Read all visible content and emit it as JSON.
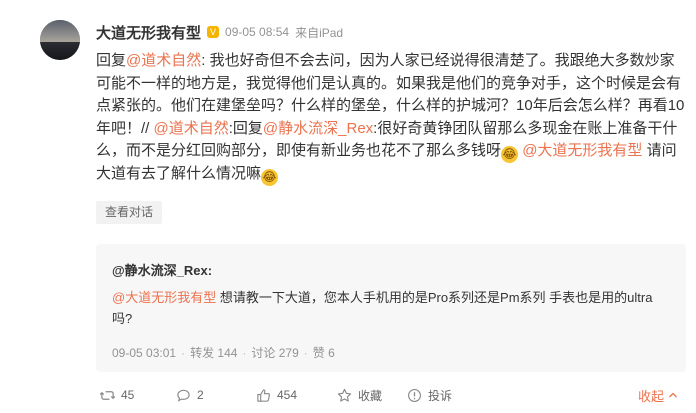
{
  "post": {
    "username": "大道无形我有型",
    "timestamp": "09-05 08:54",
    "source": "来自iPad",
    "content": [
      {
        "t": "text",
        "v": "回复"
      },
      {
        "t": "mention",
        "v": "@道术自然"
      },
      {
        "t": "text",
        "v": ": 我也好奇但不会去问，因为人家已经说得很清楚了。我跟绝大多数炒家可能不一样的地方是，我觉得他们是认真的。如果我是他们的竞争对手，这个时候是会有点紧张的。他们在建堡垒吗？什么样的堡垒，什么样的护城河？10年后会怎么样？再看10年吧！// "
      },
      {
        "t": "mention",
        "v": "@道术自然"
      },
      {
        "t": "text",
        "v": ":回复"
      },
      {
        "t": "mention",
        "v": "@静水流深_Rex"
      },
      {
        "t": "text",
        "v": ":很好奇黄铮团队留那么多现金在账上准备干什么，而不是分红回购部分，即使有新业务也花不了那么多钱呀"
      },
      {
        "t": "emoji",
        "v": "laugh-cry-emoji"
      },
      {
        "t": "text",
        "v": " "
      },
      {
        "t": "mention",
        "v": "@大道无形我有型"
      },
      {
        "t": "text",
        "v": " 请问大道有去了解什么情况嘛"
      },
      {
        "t": "emoji",
        "v": "laugh-cry-emoji"
      }
    ],
    "view_conversation_label": "查看对话"
  },
  "quoted": {
    "username": "@静水流深_Rex",
    "colon": ":",
    "mention": "@大道无形我有型",
    "text": " 想请教一下大道，您本人手机用的是Pro系列还是Pm系列 手表也是用的ultra吗?",
    "time": "09-05 03:01",
    "repost_label": "转发 144",
    "comment_label": "讨论 279",
    "like_label": "赞 6"
  },
  "actions": {
    "repost_count": "45",
    "comment_count": "2",
    "like_count": "454",
    "favorite_label": "收藏",
    "report_label": "投诉",
    "collapse_label": "收起"
  },
  "colors": {
    "accent": "#eb7350",
    "muted": "#939393",
    "text": "#333333",
    "quote_bg": "#f7f7f7"
  }
}
